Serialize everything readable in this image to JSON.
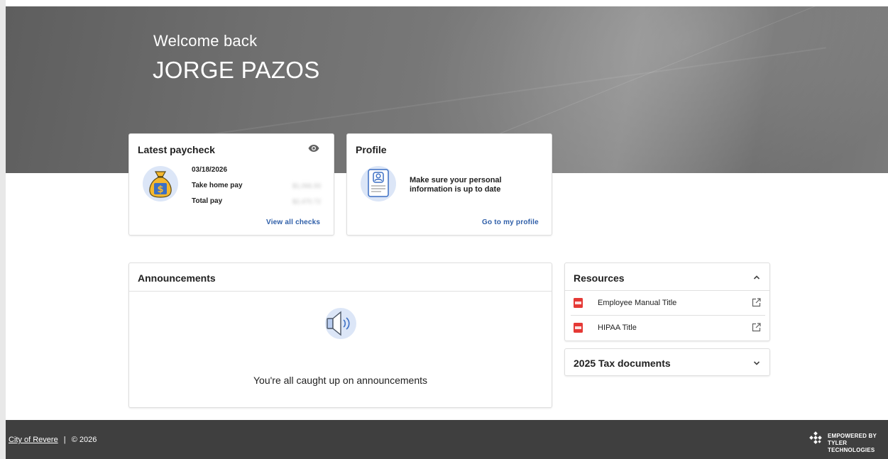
{
  "hero": {
    "welcome": "Welcome back",
    "user_name": "JORGE PAZOS"
  },
  "paycheck": {
    "title": "Latest paycheck",
    "date": "03/18/2026",
    "take_home_label": "Take home pay",
    "take_home_value": "$1,066.93",
    "total_label": "Total pay",
    "total_value": "$2,470.72",
    "link": "View all checks"
  },
  "profile": {
    "title": "Profile",
    "message": "Make sure your personal information is up to date",
    "link": "Go to my profile"
  },
  "announcements": {
    "title": "Announcements",
    "empty_message": "You're all caught up on announcements"
  },
  "resources": {
    "title": "Resources",
    "items": [
      {
        "label": "Employee Manual Title"
      },
      {
        "label": "HIPAA Title"
      }
    ]
  },
  "tax_documents": {
    "title": "2025 Tax documents"
  },
  "footer": {
    "org_link": "City of Revere",
    "separator": "|",
    "copyright": "© 2026",
    "brand_line1": "EMPOWERED BY",
    "brand_line2": "TYLER TECHNOLOGIES"
  },
  "colors": {
    "link": "#2e5ea8",
    "footer_bg": "#3f3f3f",
    "pdf_red": "#e53935",
    "icon_bg": "#dce6f7"
  }
}
